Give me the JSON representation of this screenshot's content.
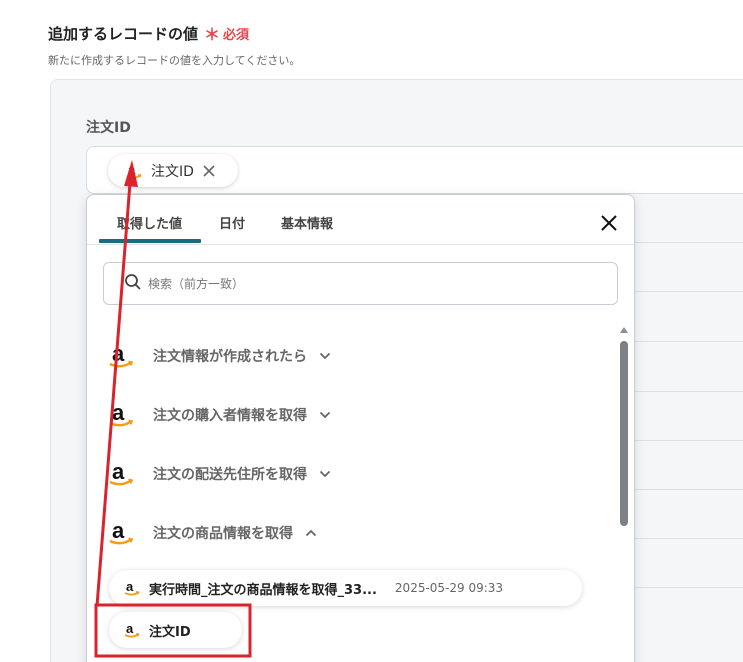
{
  "section": {
    "title": "追加するレコードの値",
    "required_mark": "＊",
    "required_text": "必須",
    "description": "新たに作成するレコードの値を入力してください。"
  },
  "field": {
    "label": "注文ID",
    "token": {
      "icon": "amazon-icon",
      "label": "注文ID"
    }
  },
  "dropdown": {
    "tabs": [
      {
        "label": "取得した値",
        "active": true
      },
      {
        "label": "日付",
        "active": false
      },
      {
        "label": "基本情報",
        "active": false
      }
    ],
    "search": {
      "placeholder": "検索（前方一致）",
      "value": ""
    },
    "groups": [
      {
        "icon": "amazon-icon",
        "label": "注文情報が作成されたら",
        "expanded": false
      },
      {
        "icon": "amazon-icon",
        "label": "注文の購入者情報を取得",
        "expanded": false
      },
      {
        "icon": "amazon-icon",
        "label": "注文の配送先住所を取得",
        "expanded": false
      },
      {
        "icon": "amazon-icon",
        "label": "注文の商品情報を取得",
        "expanded": true
      }
    ],
    "values": [
      {
        "icon": "amazon-icon",
        "label": "実行時間_注文の商品情報を取得_33...",
        "date": "2025-05-29 09:33"
      },
      {
        "icon": "amazon-icon",
        "label": "注文ID",
        "date": ""
      }
    ]
  },
  "colors": {
    "accent": "#1a6b7f",
    "required": "#e5484d",
    "annotation": "#d9232d",
    "amazon_arrow": "#f39c12"
  }
}
